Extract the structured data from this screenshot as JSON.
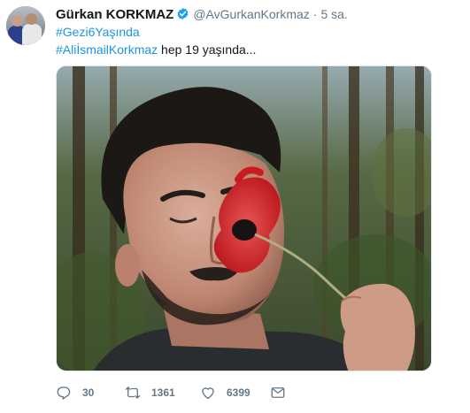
{
  "tweet": {
    "author_name": "Gürkan KORKMAZ",
    "handle": "@AvGurkanKorkmaz",
    "separator": "·",
    "time": "5 sa.",
    "hashtag1": "#Gezi6Yaşında",
    "hashtag2": "#AliİsmailKorkmaz",
    "text_rest": " hep 19 yaşında..."
  },
  "actions": {
    "reply_count": "30",
    "retweet_count": "1361",
    "like_count": "6399"
  },
  "colors": {
    "accent": "#1b95e0",
    "verified": "#1da1f2",
    "muted": "#657786"
  },
  "icons": [
    "verified-badge-icon",
    "reply-icon",
    "retweet-icon",
    "like-icon",
    "direct-message-icon"
  ]
}
